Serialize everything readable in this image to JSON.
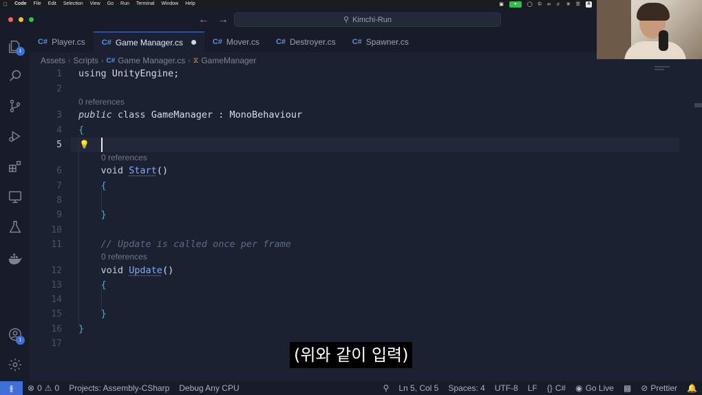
{
  "menubar": {
    "app": "Code",
    "items": [
      "File",
      "Edit",
      "Selection",
      "View",
      "Go",
      "Run",
      "Terminal",
      "Window",
      "Help"
    ],
    "keyboard_badge": "A"
  },
  "titlebar": {
    "search": "Kimchi-Run"
  },
  "activity": {
    "explorer_badge": "1",
    "account_badge": "1"
  },
  "tabs": [
    {
      "label": "Player.cs",
      "active": false
    },
    {
      "label": "Game Manager.cs",
      "active": true,
      "modified": true
    },
    {
      "label": "Mover.cs",
      "active": false
    },
    {
      "label": "Destroyer.cs",
      "active": false
    },
    {
      "label": "Spawner.cs",
      "active": false
    }
  ],
  "breadcrumb": [
    "Assets",
    "Scripts",
    "Game Manager.cs",
    "GameManager"
  ],
  "editor": {
    "current_line": "5",
    "references_label": "0 references",
    "lines": [
      {
        "n": "1",
        "tokens": [
          {
            "t": "using ",
            "c": "kw"
          },
          {
            "t": "UnityEngine;",
            "c": "type"
          }
        ]
      },
      {
        "n": "2",
        "tokens": []
      },
      {
        "n": "3",
        "tokens": [
          {
            "t": "public ",
            "c": "kw italic"
          },
          {
            "t": "class ",
            "c": "kw"
          },
          {
            "t": "GameManager : MonoBehaviour",
            "c": "type"
          }
        ]
      },
      {
        "n": "4",
        "tokens": [
          {
            "t": "{",
            "c": "brace"
          }
        ]
      },
      {
        "n": "5",
        "tokens": []
      },
      {
        "n": "6",
        "tokens": [
          {
            "t": "    void ",
            "c": "kw"
          },
          {
            "t": "Start",
            "c": "method"
          },
          {
            "t": "()",
            "c": "type"
          }
        ]
      },
      {
        "n": "7",
        "tokens": [
          {
            "t": "    {",
            "c": "brace"
          }
        ]
      },
      {
        "n": "8",
        "tokens": []
      },
      {
        "n": "9",
        "tokens": [
          {
            "t": "    }",
            "c": "brace"
          }
        ]
      },
      {
        "n": "10",
        "tokens": []
      },
      {
        "n": "11",
        "tokens": [
          {
            "t": "    // Update is called once per frame",
            "c": "comment"
          }
        ]
      },
      {
        "n": "12",
        "tokens": [
          {
            "t": "    void ",
            "c": "kw"
          },
          {
            "t": "Update",
            "c": "method"
          },
          {
            "t": "()",
            "c": "type"
          }
        ]
      },
      {
        "n": "13",
        "tokens": [
          {
            "t": "    {",
            "c": "brace"
          }
        ]
      },
      {
        "n": "14",
        "tokens": []
      },
      {
        "n": "15",
        "tokens": [
          {
            "t": "    }",
            "c": "brace"
          }
        ]
      },
      {
        "n": "16",
        "tokens": [
          {
            "t": "}",
            "c": "brace"
          }
        ]
      },
      {
        "n": "17",
        "tokens": []
      }
    ]
  },
  "subtitle": "(위와 같이 입력)",
  "statusbar": {
    "errors": "0",
    "warnings": "0",
    "project": "Projects: Assembly-CSharp",
    "debug": "Debug Any CPU",
    "position": "Ln 5, Col 5",
    "spaces": "Spaces: 4",
    "encoding": "UTF-8",
    "eol": "LF",
    "language": "C#",
    "golive": "Go Live",
    "prettier": "Prettier"
  },
  "colors": {
    "accent": "#3f6fd8",
    "background": "#1b2130",
    "method": "#82aaff",
    "brace": "#5aa8c0"
  }
}
